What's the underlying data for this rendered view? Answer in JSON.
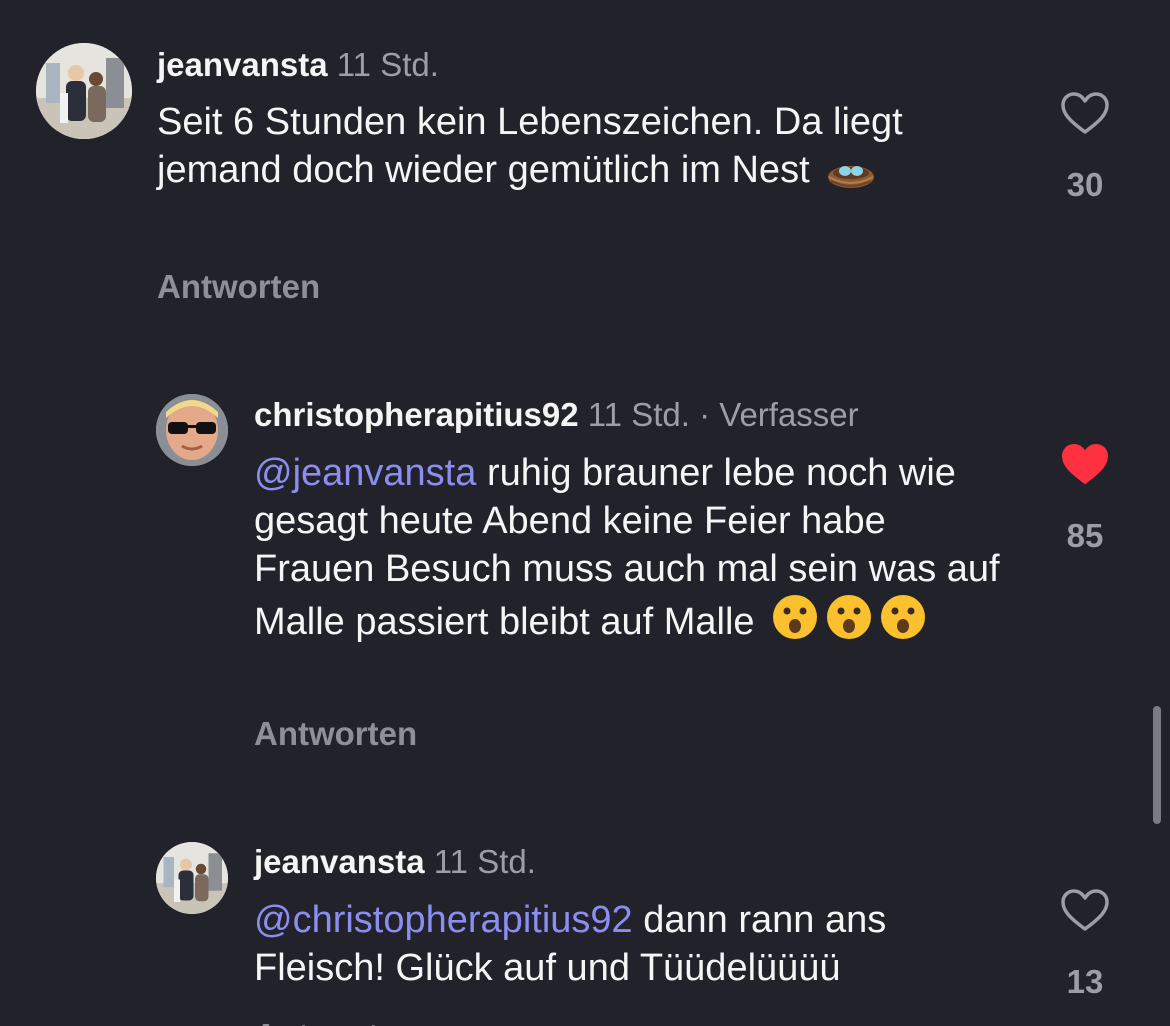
{
  "comments": [
    {
      "username": "jeanvansta",
      "time": "11 Std.",
      "text": "Seit 6 Stunden kein Lebenszeichen. Da liegt jemand doch wieder gemütlich im Nest",
      "emoji_icon": "nest-eggs-emoji",
      "reply_label": "Antworten",
      "like_count": "30",
      "liked": false
    },
    {
      "username": "christopherapitius92",
      "time": "11 Std.",
      "separator": "·",
      "author_badge": "Verfasser",
      "mention": "@jeanvansta",
      "text": "ruhig brauner lebe noch wie gesagt heute Abend keine Feier habe Frauen Besuch muss auch mal sein was auf Malle passiert bleibt auf Malle",
      "emoji_icon": "astonished-face-emoji",
      "reply_label": "Antworten",
      "like_count": "85",
      "liked": true
    },
    {
      "username": "jeanvansta",
      "time": "11 Std.",
      "mention": "@christopherapitius92",
      "text": "dann rann ans Fleisch! Glück auf und Tüüdelüüüü",
      "reply_label": "Antworten",
      "like_count": "13",
      "liked": false
    }
  ],
  "colors": {
    "background": "#22232a",
    "text": "#f5f5f5",
    "meta": "#9b9ea6",
    "mention": "#8b8df0",
    "like_active": "#ff3040"
  }
}
